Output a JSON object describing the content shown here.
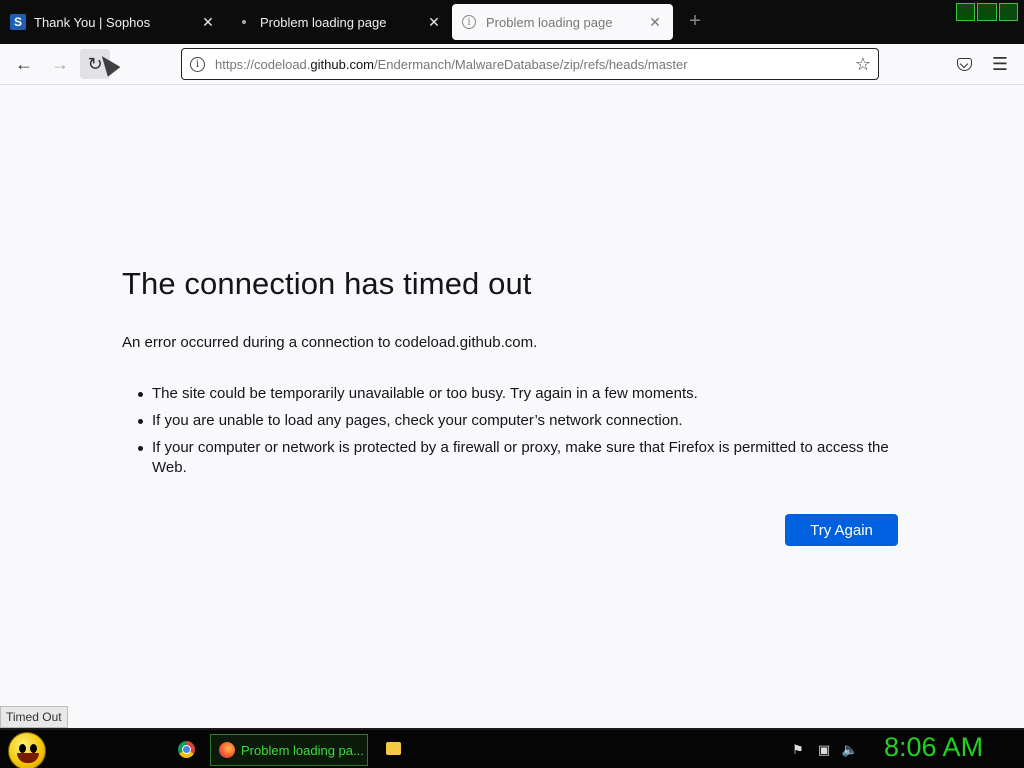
{
  "tabs": [
    {
      "title": "Thank You | Sophos",
      "favicon": "S",
      "active": false
    },
    {
      "title": "Problem loading page",
      "active": false
    },
    {
      "title": "Problem loading page",
      "active": true
    }
  ],
  "toolbar": {
    "url_prefix": "https://codeload.",
    "url_host": "github.com",
    "url_path": "/Endermanch/MalwareDatabase/zip/refs/heads/master"
  },
  "error": {
    "title": "The connection has timed out",
    "description": "An error occurred during a connection to codeload.github.com.",
    "suggestions": [
      "The site could be temporarily unavailable or too busy. Try again in a few moments.",
      "If you are unable to load any pages, check your computer’s network connection.",
      "If your computer or network is protected by a firewall or proxy, make sure that Firefox is permitted to access the Web."
    ],
    "try_again_label": "Try Again"
  },
  "status_tooltip": "Timed Out",
  "taskbar": {
    "firefox_task_label": "Problem loading pa...",
    "clock": "8:06 AM"
  },
  "colors": {
    "primary_button": "#0061e0",
    "clock": "#22d022",
    "page_background": "#f9f9fb"
  }
}
